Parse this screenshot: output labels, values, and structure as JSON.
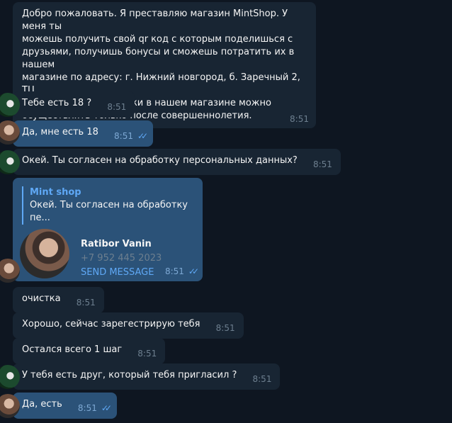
{
  "messages": [
    {
      "text": "Добро пожаловать. Я преставляю магазин MintShop. У меня ты\nможешь получить свой qr код с которым поделишься с\nдрузьями, получишь бонусы и сможешь потратить их в нашем\nмагазине по адресу: г. Нижний новгород, б. Заречный 2, ТЦ\nКорона, 2 этаж. Покупки в нашем магазине можно\nосуществлять только после совершеннолетия.",
      "time": "8:51"
    },
    {
      "text": "Тебе есть 18 ?",
      "time": "8:51"
    },
    {
      "text": "Да, мне есть 18",
      "time": "8:51"
    },
    {
      "text": "Окей. Ты согласен на обработку персональных данных?",
      "time": "8:51"
    },
    {
      "reply_title": "Mint shop",
      "reply_text": "Окей. Ты согласен на обработку пе...",
      "contact_name": "Ratibor Vanin",
      "contact_phone": "+7 952 445 2023",
      "contact_action": "SEND MESSAGE",
      "time": "8:51"
    },
    {
      "text": "очистка",
      "time": "8:51"
    },
    {
      "text": "Хорошо, сейчас зарегестрирую тебя",
      "time": "8:51"
    },
    {
      "text": "Остался всего 1 шаг",
      "time": "8:51"
    },
    {
      "text": "У тебя есть друг, который тебя пригласил ?",
      "time": "8:51"
    },
    {
      "text": "Да, есть",
      "time": "8:51"
    }
  ],
  "colors": {
    "background": "#0e1621",
    "incoming_bubble": "#182533",
    "outgoing_bubble": "#2b5278",
    "accent": "#5fa8f5"
  },
  "icons": [
    "bot-avatar-icon",
    "user-avatar-icon",
    "double-check-icon"
  ]
}
